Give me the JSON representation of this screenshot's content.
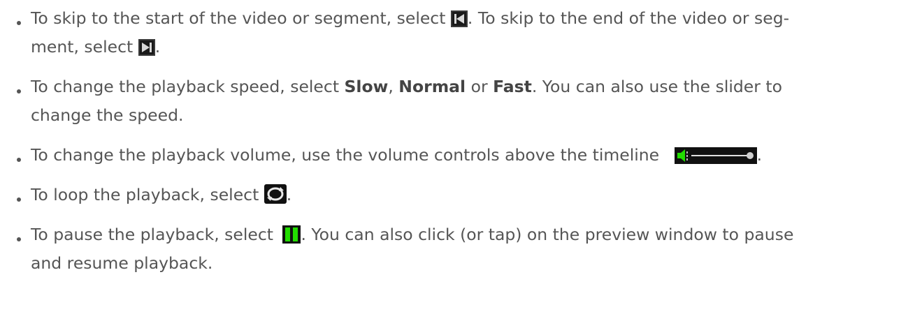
{
  "bullets": [
    {
      "t1": "To skip to the start of the video or segment, select ",
      "t2": ". To skip to the end of the video or seg-",
      "t3": "ment, select ",
      "t4": ".",
      "icon1": "skip-to-start-icon",
      "icon2": "skip-to-end-icon"
    },
    {
      "t1": "To change the playback speed, select ",
      "kw1": "Slow",
      "t2": ", ",
      "kw2": "Normal",
      "t3": " or ",
      "kw3": "Fast",
      "t4": ". You can also use the slider to",
      "t5": "change the speed."
    },
    {
      "t1": "To change the playback volume, use the volume controls above the timeline ",
      "t2": ".",
      "icon1": "volume-slider-icon"
    },
    {
      "t1": "To loop the playback, select ",
      "t2": ".",
      "icon1": "loop-icon"
    },
    {
      "t1": "To pause the playback, select ",
      "t2": ". You can also click (or tap) on the preview window to pause",
      "t3": "and resume playback.",
      "icon1": "pause-icon"
    }
  ],
  "colors": {
    "text": "#555555",
    "icon_bg": "#111111",
    "icon_green": "#22dd00"
  }
}
